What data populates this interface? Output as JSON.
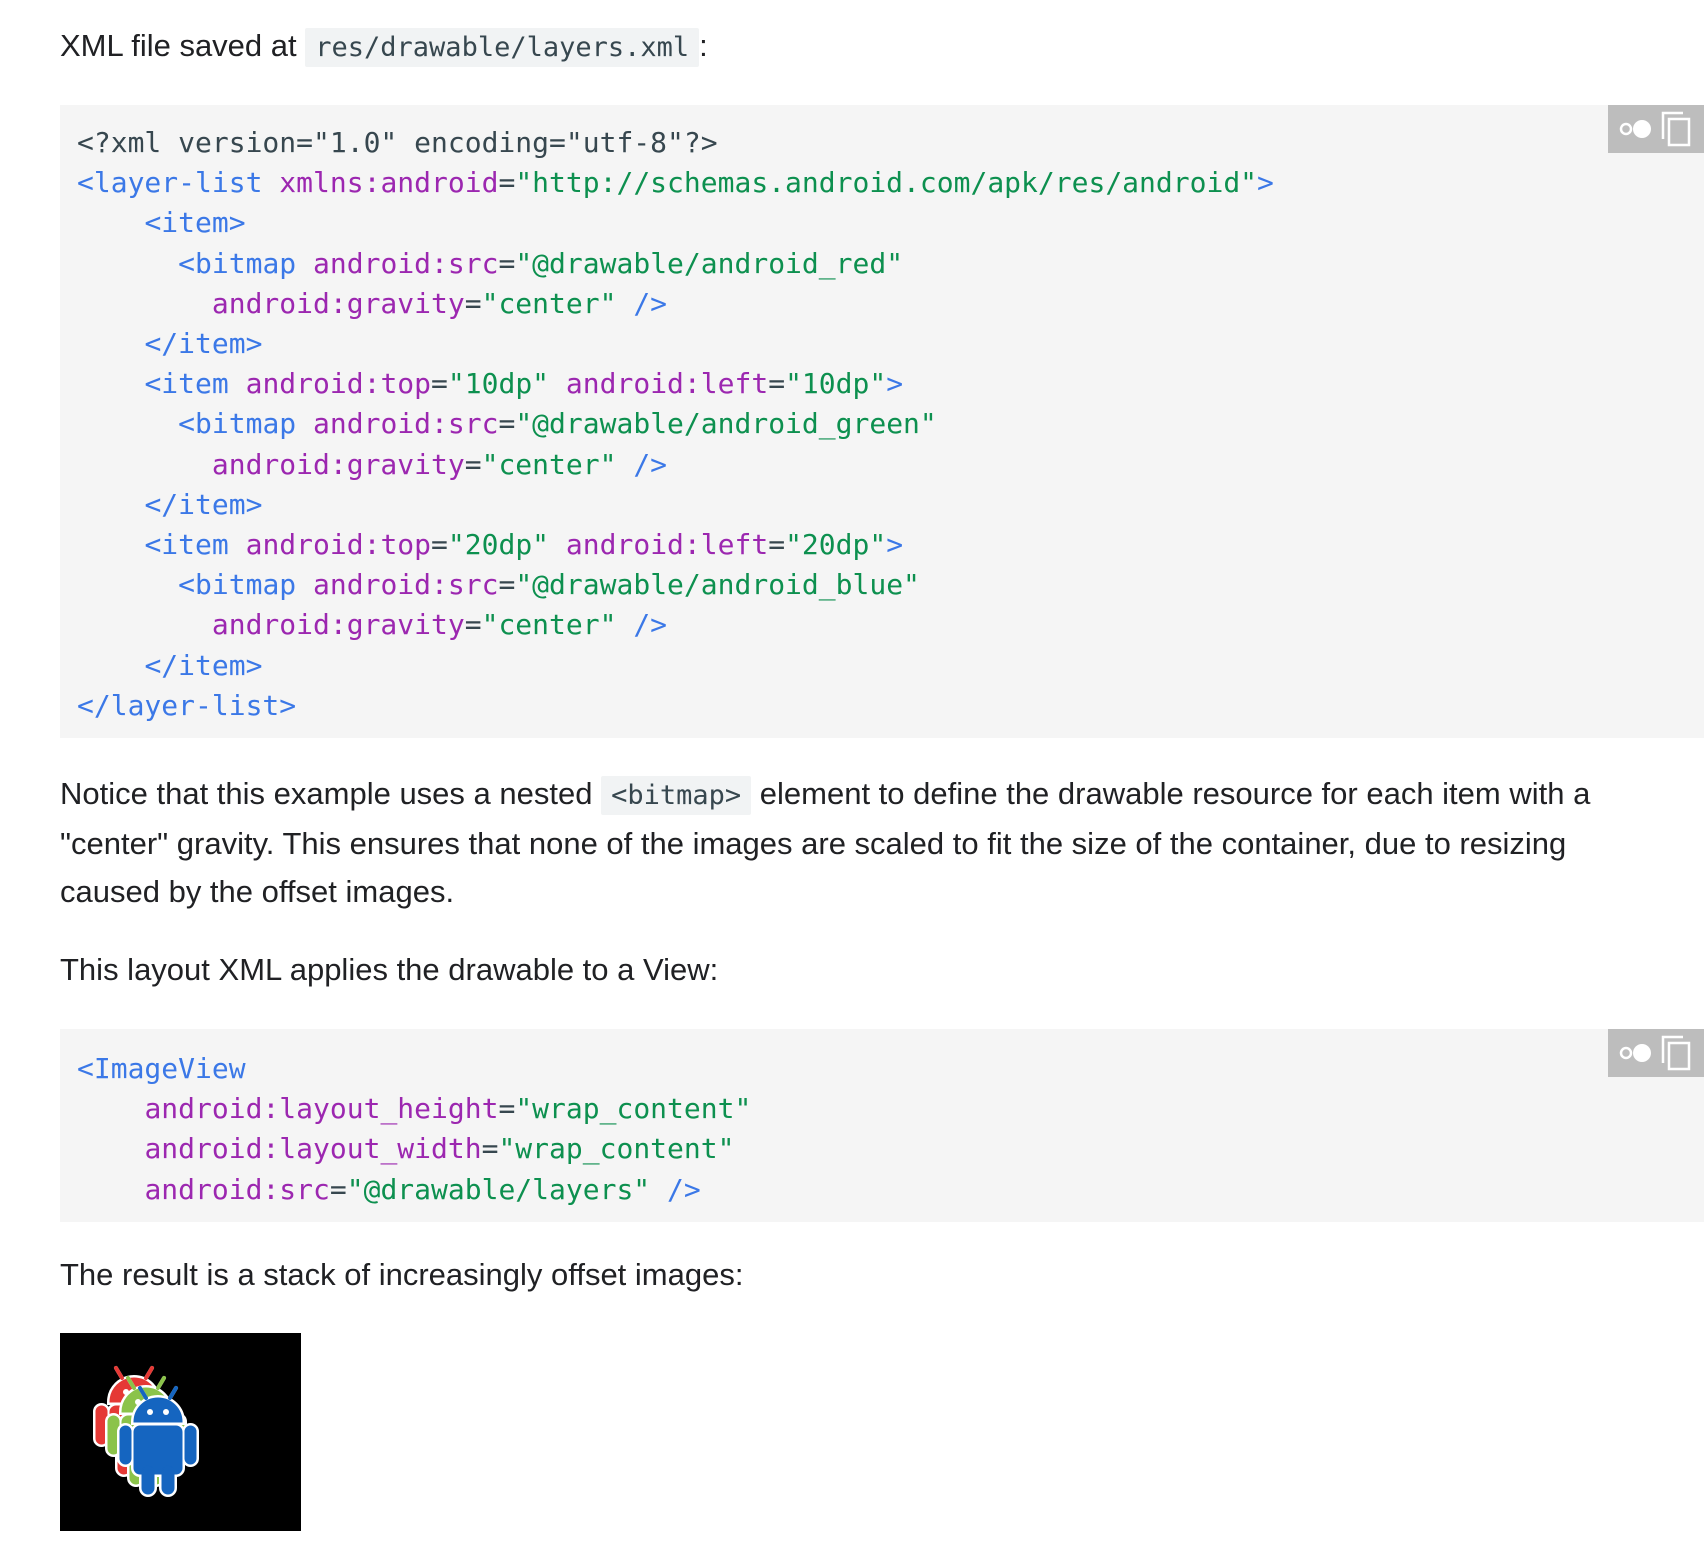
{
  "intro": {
    "prefix": "XML file saved at",
    "path": "res/drawable/layers.xml",
    "suffix": ":"
  },
  "layers_code": {
    "lines": [
      [
        {
          "t": "punc",
          "s": "<?xml version=\"1.0\" encoding=\"utf-8\"?>"
        }
      ],
      [
        {
          "t": "tag",
          "s": "<layer-list"
        },
        {
          "t": "punc",
          "s": " "
        },
        {
          "t": "attr",
          "s": "xmlns:android"
        },
        {
          "t": "punc",
          "s": "="
        },
        {
          "t": "str",
          "s": "\"http://schemas.android.com/apk/res/android\""
        },
        {
          "t": "tag",
          "s": ">"
        }
      ],
      [
        {
          "t": "punc",
          "s": "    "
        },
        {
          "t": "tag",
          "s": "<item>"
        }
      ],
      [
        {
          "t": "punc",
          "s": "      "
        },
        {
          "t": "tag",
          "s": "<bitmap"
        },
        {
          "t": "punc",
          "s": " "
        },
        {
          "t": "attr",
          "s": "android:src"
        },
        {
          "t": "punc",
          "s": "="
        },
        {
          "t": "str",
          "s": "\"@drawable/android_red\""
        }
      ],
      [
        {
          "t": "punc",
          "s": "        "
        },
        {
          "t": "attr",
          "s": "android:gravity"
        },
        {
          "t": "punc",
          "s": "="
        },
        {
          "t": "str",
          "s": "\"center\""
        },
        {
          "t": "punc",
          "s": " "
        },
        {
          "t": "tag",
          "s": "/>"
        }
      ],
      [
        {
          "t": "punc",
          "s": "    "
        },
        {
          "t": "tag",
          "s": "</item>"
        }
      ],
      [
        {
          "t": "punc",
          "s": "    "
        },
        {
          "t": "tag",
          "s": "<item"
        },
        {
          "t": "punc",
          "s": " "
        },
        {
          "t": "attr",
          "s": "android:top"
        },
        {
          "t": "punc",
          "s": "="
        },
        {
          "t": "str",
          "s": "\"10dp\""
        },
        {
          "t": "punc",
          "s": " "
        },
        {
          "t": "attr",
          "s": "android:left"
        },
        {
          "t": "punc",
          "s": "="
        },
        {
          "t": "str",
          "s": "\"10dp\""
        },
        {
          "t": "tag",
          "s": ">"
        }
      ],
      [
        {
          "t": "punc",
          "s": "      "
        },
        {
          "t": "tag",
          "s": "<bitmap"
        },
        {
          "t": "punc",
          "s": " "
        },
        {
          "t": "attr",
          "s": "android:src"
        },
        {
          "t": "punc",
          "s": "="
        },
        {
          "t": "str",
          "s": "\"@drawable/android_green\""
        }
      ],
      [
        {
          "t": "punc",
          "s": "        "
        },
        {
          "t": "attr",
          "s": "android:gravity"
        },
        {
          "t": "punc",
          "s": "="
        },
        {
          "t": "str",
          "s": "\"center\""
        },
        {
          "t": "punc",
          "s": " "
        },
        {
          "t": "tag",
          "s": "/>"
        }
      ],
      [
        {
          "t": "punc",
          "s": "    "
        },
        {
          "t": "tag",
          "s": "</item>"
        }
      ],
      [
        {
          "t": "punc",
          "s": "    "
        },
        {
          "t": "tag",
          "s": "<item"
        },
        {
          "t": "punc",
          "s": " "
        },
        {
          "t": "attr",
          "s": "android:top"
        },
        {
          "t": "punc",
          "s": "="
        },
        {
          "t": "str",
          "s": "\"20dp\""
        },
        {
          "t": "punc",
          "s": " "
        },
        {
          "t": "attr",
          "s": "android:left"
        },
        {
          "t": "punc",
          "s": "="
        },
        {
          "t": "str",
          "s": "\"20dp\""
        },
        {
          "t": "tag",
          "s": ">"
        }
      ],
      [
        {
          "t": "punc",
          "s": "      "
        },
        {
          "t": "tag",
          "s": "<bitmap"
        },
        {
          "t": "punc",
          "s": " "
        },
        {
          "t": "attr",
          "s": "android:src"
        },
        {
          "t": "punc",
          "s": "="
        },
        {
          "t": "str",
          "s": "\"@drawable/android_blue\""
        }
      ],
      [
        {
          "t": "punc",
          "s": "        "
        },
        {
          "t": "attr",
          "s": "android:gravity"
        },
        {
          "t": "punc",
          "s": "="
        },
        {
          "t": "str",
          "s": "\"center\""
        },
        {
          "t": "punc",
          "s": " "
        },
        {
          "t": "tag",
          "s": "/>"
        }
      ],
      [
        {
          "t": "punc",
          "s": "    "
        },
        {
          "t": "tag",
          "s": "</item>"
        }
      ],
      [
        {
          "t": "tag",
          "s": "</layer-list>"
        }
      ]
    ]
  },
  "notice_paragraph": {
    "before": "Notice that this example uses a nested",
    "code": "<bitmap>",
    "after": "element to define the drawable resource for each item with a \"center\" gravity. This ensures that none of the images are scaled to fit the size of the container, due to resizing caused by the offset images."
  },
  "layout_intro": "This layout XML applies the drawable to a View:",
  "imageview_code": {
    "lines": [
      [
        {
          "t": "tag",
          "s": "<ImageView"
        }
      ],
      [
        {
          "t": "punc",
          "s": "    "
        },
        {
          "t": "attr",
          "s": "android:layout_height"
        },
        {
          "t": "punc",
          "s": "="
        },
        {
          "t": "str",
          "s": "\"wrap_content\""
        }
      ],
      [
        {
          "t": "punc",
          "s": "    "
        },
        {
          "t": "attr",
          "s": "android:layout_width"
        },
        {
          "t": "punc",
          "s": "="
        },
        {
          "t": "str",
          "s": "\"wrap_content\""
        }
      ],
      [
        {
          "t": "punc",
          "s": "    "
        },
        {
          "t": "attr",
          "s": "android:src"
        },
        {
          "t": "punc",
          "s": "="
        },
        {
          "t": "str",
          "s": "\"@drawable/layers\""
        },
        {
          "t": "punc",
          "s": " "
        },
        {
          "t": "tag",
          "s": "/>"
        }
      ]
    ]
  },
  "result_text": "The result is a stack of increasingly offset images:",
  "toolbar_icons": [
    "theme-toggle-icon",
    "copy-icon"
  ],
  "colors": {
    "tag": "#3b78e7",
    "attr": "#9c27b0",
    "string": "#0d904f",
    "code_bg": "#f5f5f5",
    "toolbar_bg": "#bdbdbd",
    "android_red": "#e53935",
    "android_green": "#8bc34a",
    "android_blue": "#1565c0"
  }
}
